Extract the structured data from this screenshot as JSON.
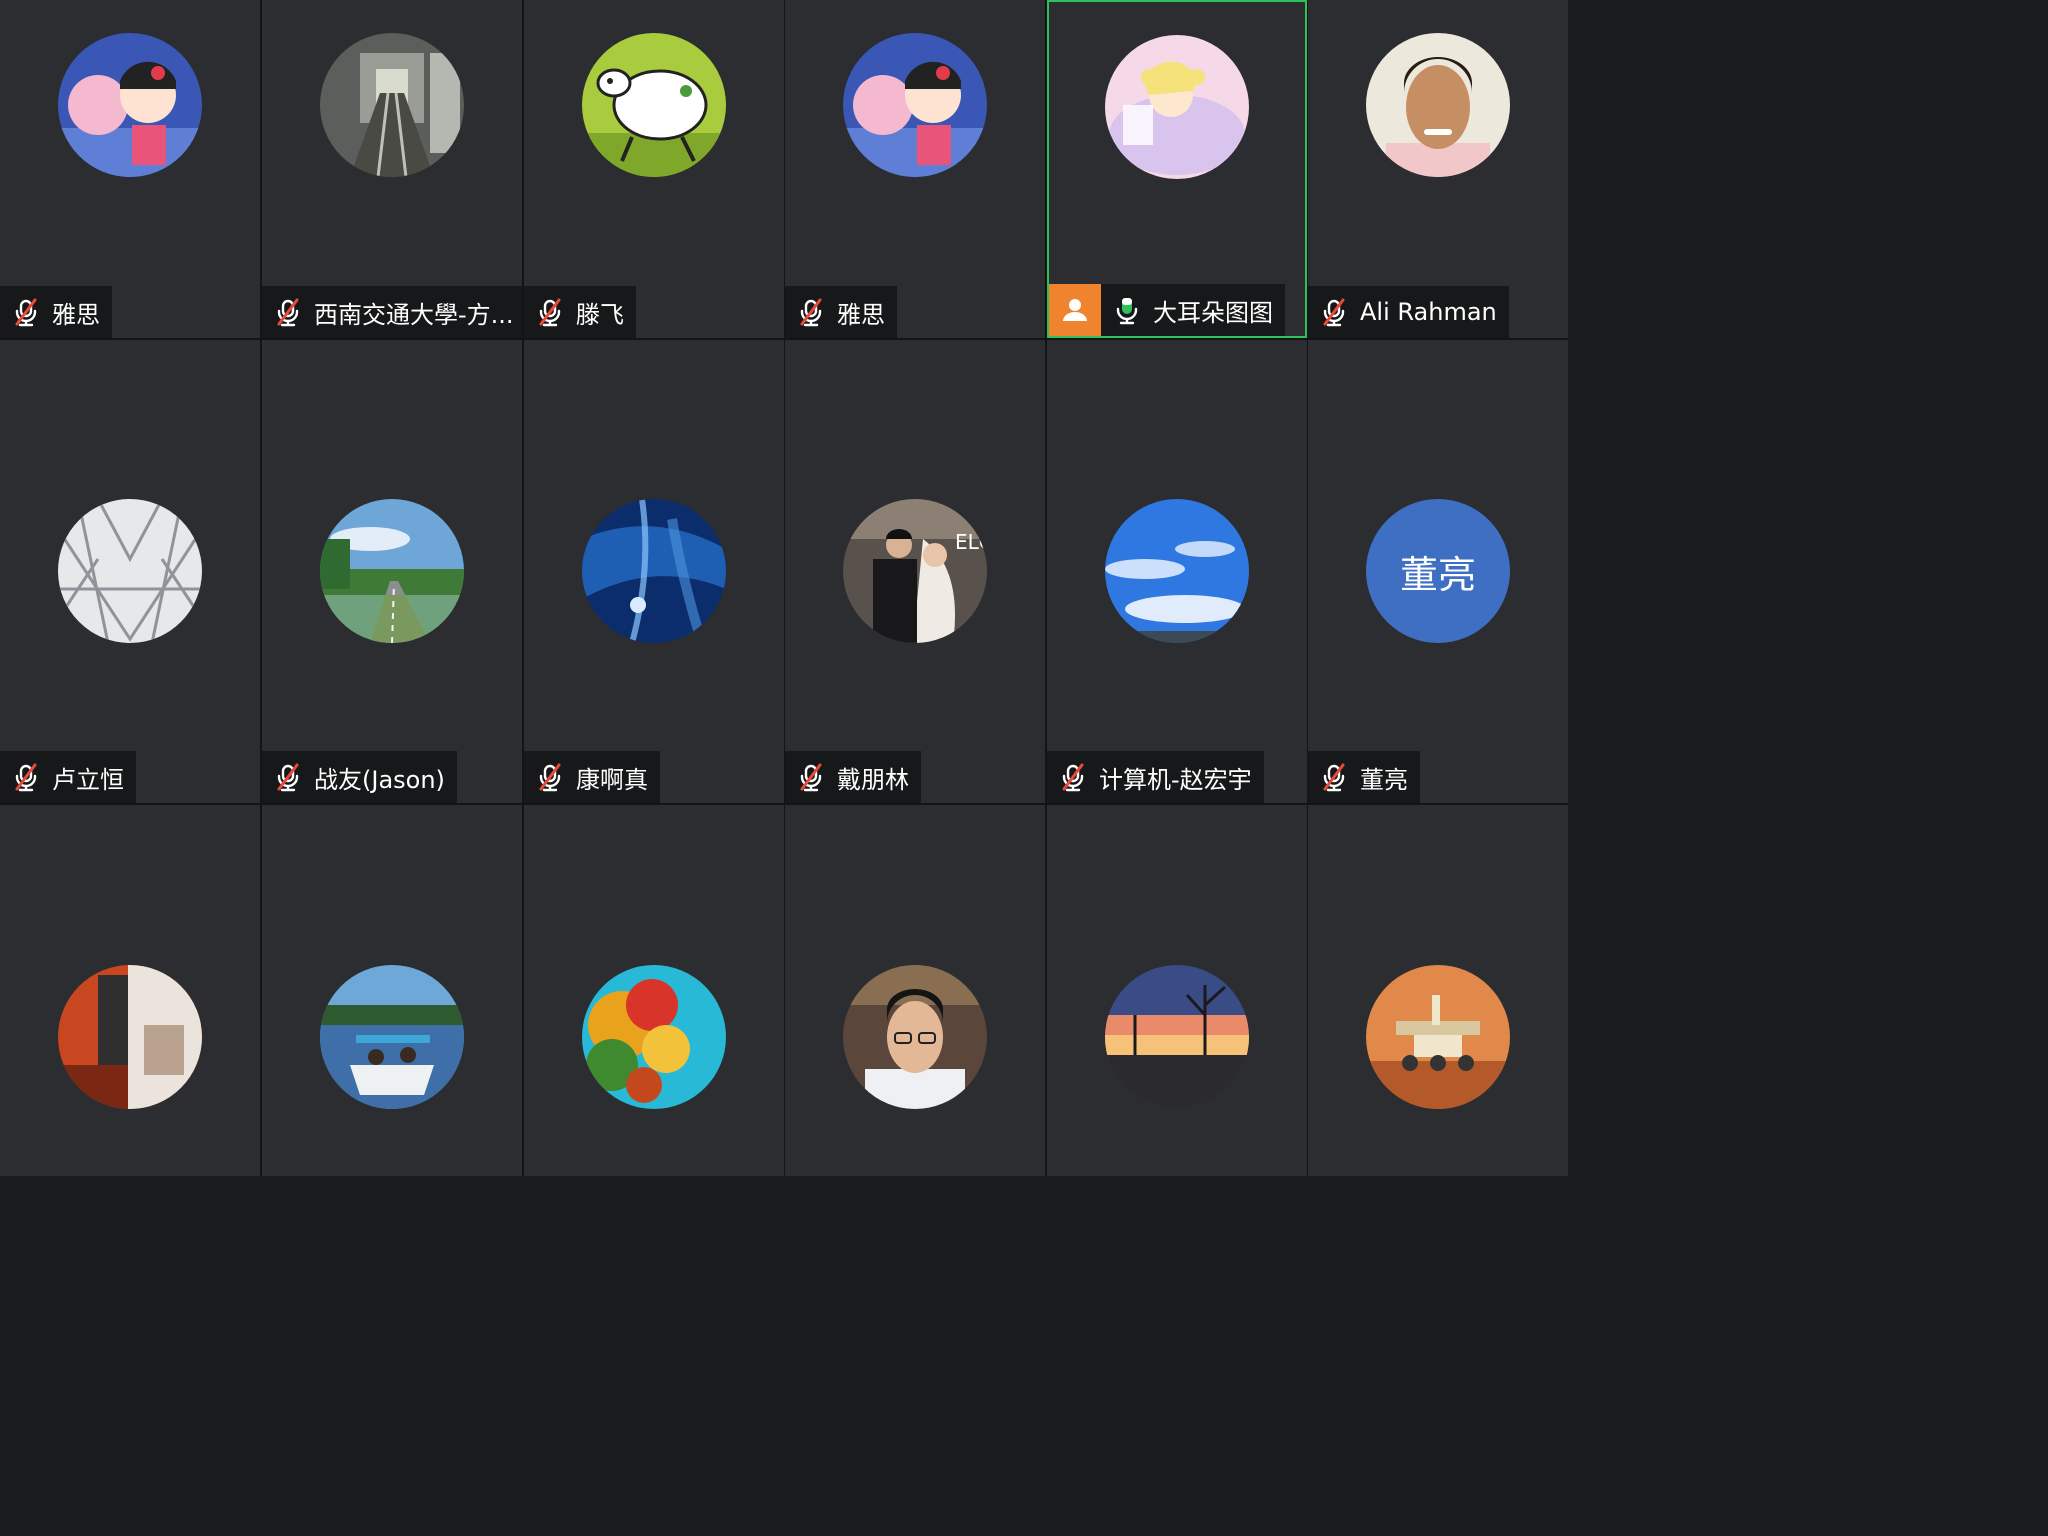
{
  "meeting": {
    "participants": [
      {
        "name": "雅思",
        "mic": "muted",
        "avatar": "cartoon-girl-cotton-candy"
      },
      {
        "name": "西南交通大學-方...",
        "mic": "muted",
        "avatar": "subway-track"
      },
      {
        "name": "滕飞",
        "mic": "muted",
        "avatar": "cartoon-sheep"
      },
      {
        "name": "雅思",
        "mic": "muted",
        "avatar": "cartoon-girl-cotton-candy"
      },
      {
        "name": "大耳朵图图",
        "mic": "active",
        "avatar": "anime-sleeping-girl",
        "host": true,
        "active_speaker": true
      },
      {
        "name": "Ali Rahman",
        "mic": "muted",
        "avatar": "man-portrait"
      },
      {
        "name": "卢立恒",
        "mic": "muted",
        "avatar": "white-architecture"
      },
      {
        "name": "战友(Jason)",
        "mic": "muted",
        "avatar": "country-road"
      },
      {
        "name": "康啊真",
        "mic": "muted",
        "avatar": "blue-ocean"
      },
      {
        "name": "戴朋林",
        "mic": "muted",
        "avatar": "wedding-couple"
      },
      {
        "name": "计算机-赵宏宇",
        "mic": "muted",
        "avatar": "blue-sky-clouds"
      },
      {
        "name": "董亮",
        "mic": "muted",
        "avatar": "initials",
        "initials": "董亮"
      },
      {
        "name": "",
        "mic": "muted",
        "avatar": "red-interior"
      },
      {
        "name": "",
        "mic": "muted",
        "avatar": "boat-on-lake"
      },
      {
        "name": "",
        "mic": "muted",
        "avatar": "autumn-trees"
      },
      {
        "name": "",
        "mic": "muted",
        "avatar": "man-with-glasses"
      },
      {
        "name": "",
        "mic": "muted",
        "avatar": "sunset-trees"
      },
      {
        "name": "",
        "mic": "muted",
        "avatar": "mars-rover"
      }
    ]
  },
  "colors": {
    "tile_bg": "#2b2d31",
    "active_border": "#2fc15a",
    "host_badge": "#f0832e",
    "mic_active": "#2fc15a",
    "mic_muted_slash": "#e84a3c",
    "initials_bg": "#3f6fc2"
  }
}
